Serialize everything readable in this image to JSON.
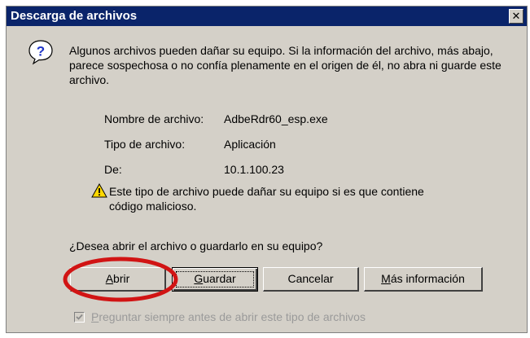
{
  "window": {
    "title": "Descarga de archivos",
    "close_glyph": "✕"
  },
  "message": "Algunos archivos pueden dañar su equipo. Si la información del archivo, más abajo, parece sospechosa o no confía plenamente en el origen de él, no abra ni guarde este archivo.",
  "file_info": [
    {
      "label": "Nombre de archivo:",
      "value": "AdbeRdr60_esp.exe"
    },
    {
      "label": "Tipo de archivo:",
      "value": "Aplicación"
    },
    {
      "label": "De:",
      "value": "10.1.100.23"
    }
  ],
  "warning": "Este tipo de archivo puede dañar su equipo si es que contiene código malicioso.",
  "question": "¿Desea abrir el archivo o guardarlo en su equipo?",
  "buttons": {
    "open": {
      "mnemonic": "A",
      "rest": "brir"
    },
    "save": {
      "mnemonic": "G",
      "rest": "uardar"
    },
    "cancel": {
      "label": "Cancelar"
    },
    "more": {
      "mnemonic": "M",
      "rest": "ás información"
    }
  },
  "checkbox": {
    "mnemonic": "P",
    "rest": "reguntar siempre antes de abrir este tipo de archivos",
    "checked": true,
    "disabled": true
  },
  "icons": {
    "question": "question-icon",
    "warning": "warning-icon",
    "highlight": "red-highlight-ellipse"
  },
  "colors": {
    "titlebar": "#0a246a",
    "dialog": "#d4d0c8",
    "highlight": "#d11414"
  }
}
